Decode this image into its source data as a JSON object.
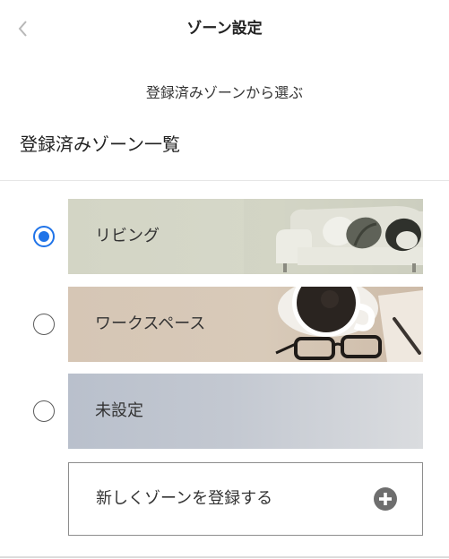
{
  "header": {
    "title": "ゾーン設定",
    "back_icon": "chevron-left-icon"
  },
  "subtitle": "登録済みゾーンから選ぶ",
  "section_title": "登録済みゾーン一覧",
  "zones": [
    {
      "label": "リビング",
      "selected": true,
      "image": "sofa"
    },
    {
      "label": "ワークスペース",
      "selected": false,
      "image": "coffee-and-glasses"
    },
    {
      "label": "未設定",
      "selected": false,
      "image": "none"
    }
  ],
  "new_zone": {
    "label": "新しくゾーンを登録する",
    "icon": "plus-circle-icon"
  },
  "colors": {
    "accent": "#1f73e8",
    "radio_border": "#5a5a5a"
  }
}
